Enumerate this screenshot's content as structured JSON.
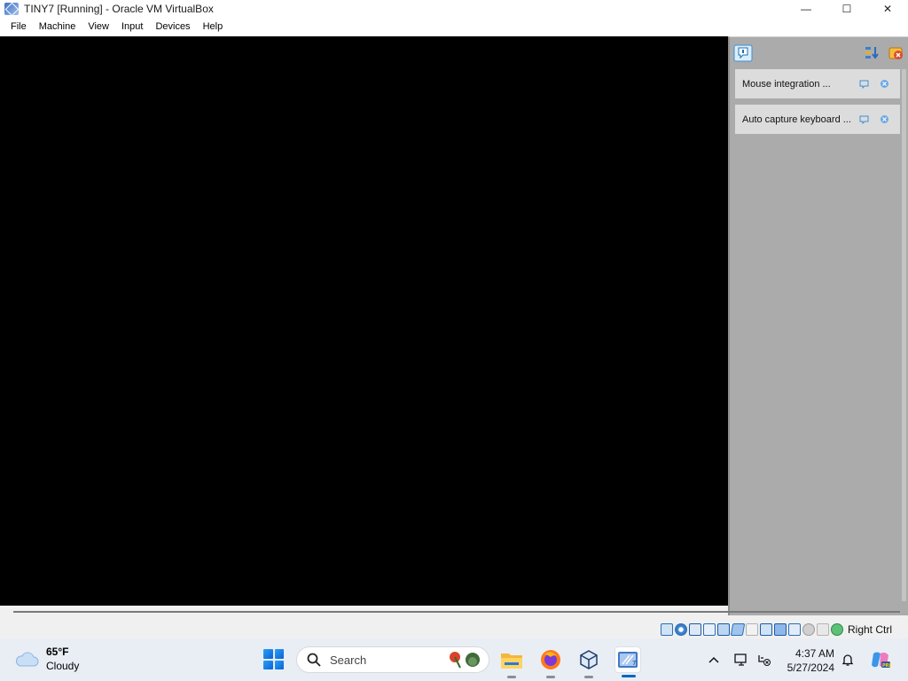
{
  "window": {
    "title": "TINY7 [Running] - Oracle VM VirtualBox",
    "minimize_glyph": "—",
    "maximize_glyph": "☐",
    "close_glyph": "✕"
  },
  "menu": {
    "items": [
      "File",
      "Machine",
      "View",
      "Input",
      "Devices",
      "Help"
    ]
  },
  "notifications": {
    "items": [
      {
        "label": "Mouse integration ..."
      },
      {
        "label": "Auto capture keyboard ..."
      }
    ]
  },
  "statusbar": {
    "host_key": "Right Ctrl",
    "icons": [
      "hard-disk-icon",
      "optical-drive-icon",
      "floppy-icon",
      "audio-icon",
      "network-icon",
      "usb-icon",
      "shared-folders-icon",
      "display-icon",
      "recording-icon",
      "video-capture-icon",
      "virtualization-icon",
      "cpu-icon",
      "mouse-integration-icon",
      "keyboard-capture-icon"
    ]
  },
  "taskbar": {
    "weather": {
      "temp": "65°F",
      "condition": "Cloudy"
    },
    "search_placeholder": "Search",
    "clock": {
      "time": "4:37 AM",
      "date": "5/27/2024"
    }
  },
  "colors": {
    "vm_screen": "#000000",
    "panel_bg": "#ababab",
    "notif_bg": "#dcdcdc",
    "taskbar_bg": "#e9eef5",
    "accent": "#0067c0"
  }
}
